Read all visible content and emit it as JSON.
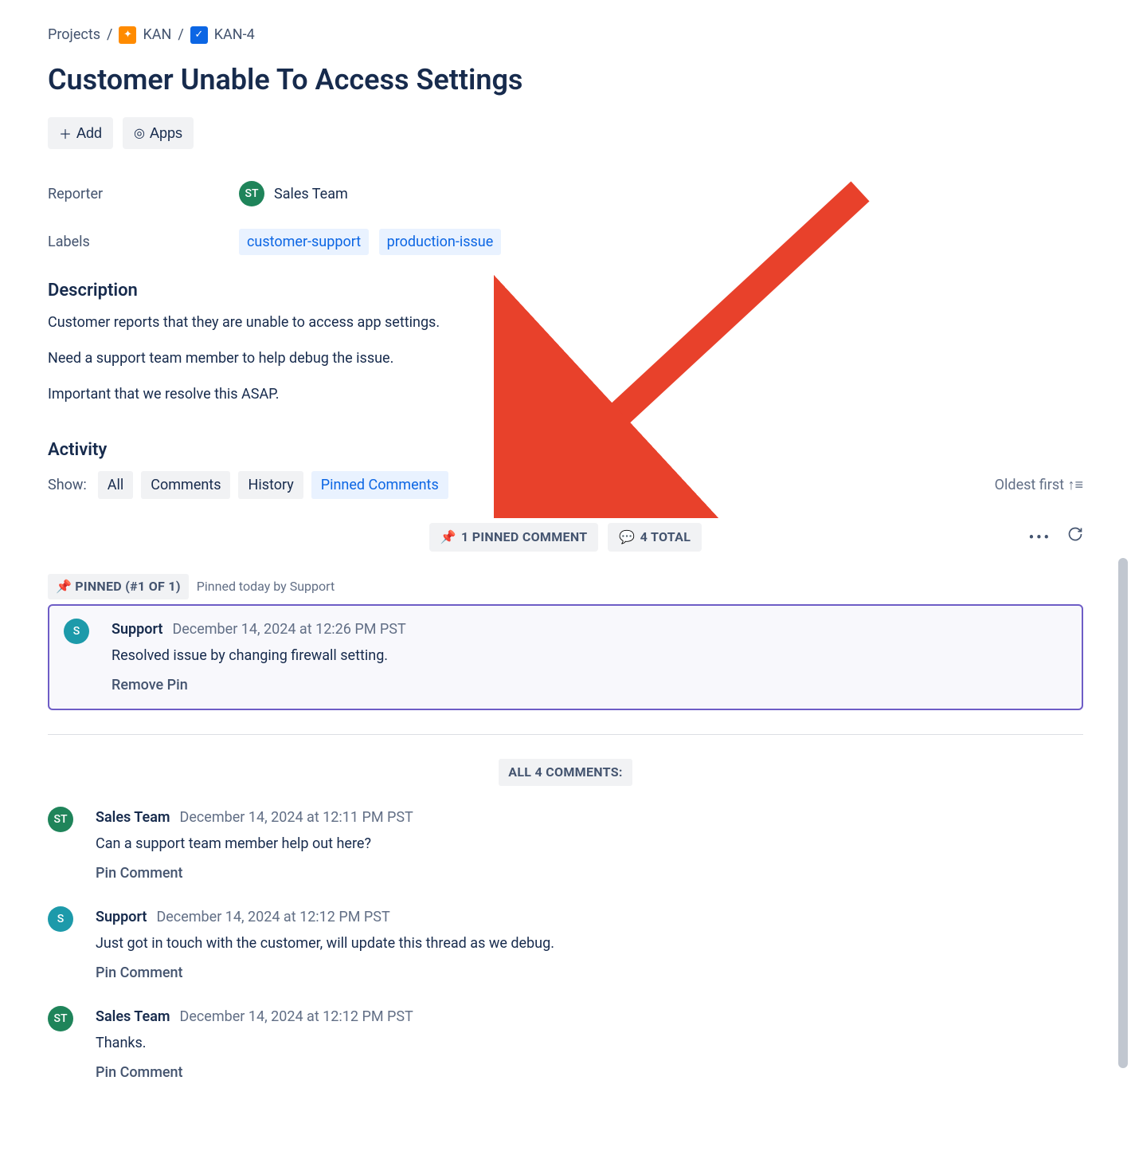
{
  "breadcrumb": {
    "projects": "Projects",
    "project": "KAN",
    "issue": "KAN-4"
  },
  "title": "Customer Unable To Access Settings",
  "actions": {
    "add": "Add",
    "apps": "Apps"
  },
  "fields": {
    "reporter_label": "Reporter",
    "reporter_initials": "ST",
    "reporter_name": "Sales Team",
    "labels_label": "Labels",
    "labels": [
      "customer-support",
      "production-issue"
    ]
  },
  "description": {
    "heading": "Description",
    "p1": "Customer reports that they are unable to access app settings.",
    "p2": "Need a support team member to help debug the issue.",
    "p3": "Important that we resolve this ASAP."
  },
  "activity": {
    "heading": "Activity",
    "show_label": "Show:",
    "tabs": {
      "all": "All",
      "comments": "Comments",
      "history": "History",
      "pinned": "Pinned Comments"
    },
    "sort": "Oldest first",
    "pinned_count_badge": "1 PINNED COMMENT",
    "total_badge": "4 TOTAL",
    "pinned_header_badge": "PINNED (#1 OF 1)",
    "pinned_by": "Pinned today by Support",
    "all_comments_label": "ALL 4 COMMENTS:"
  },
  "pinned_comment": {
    "initials": "S",
    "author": "Support",
    "date": "December 14, 2024 at 12:26 PM PST",
    "text": "Resolved issue by changing firewall setting.",
    "action": "Remove Pin"
  },
  "comments": [
    {
      "initials": "ST",
      "avatar_class": "avatar-green",
      "author": "Sales Team",
      "date": "December 14, 2024 at 12:11 PM PST",
      "text": "Can a support team member help out here?",
      "action": "Pin Comment"
    },
    {
      "initials": "S",
      "avatar_class": "avatar-teal",
      "author": "Support",
      "date": "December 14, 2024 at 12:12 PM PST",
      "text": "Just got in touch with the customer, will update this thread as we debug.",
      "action": "Pin Comment"
    },
    {
      "initials": "ST",
      "avatar_class": "avatar-green",
      "author": "Sales Team",
      "date": "December 14, 2024 at 12:12 PM PST",
      "text": "Thanks.",
      "action": "Pin Comment"
    }
  ]
}
